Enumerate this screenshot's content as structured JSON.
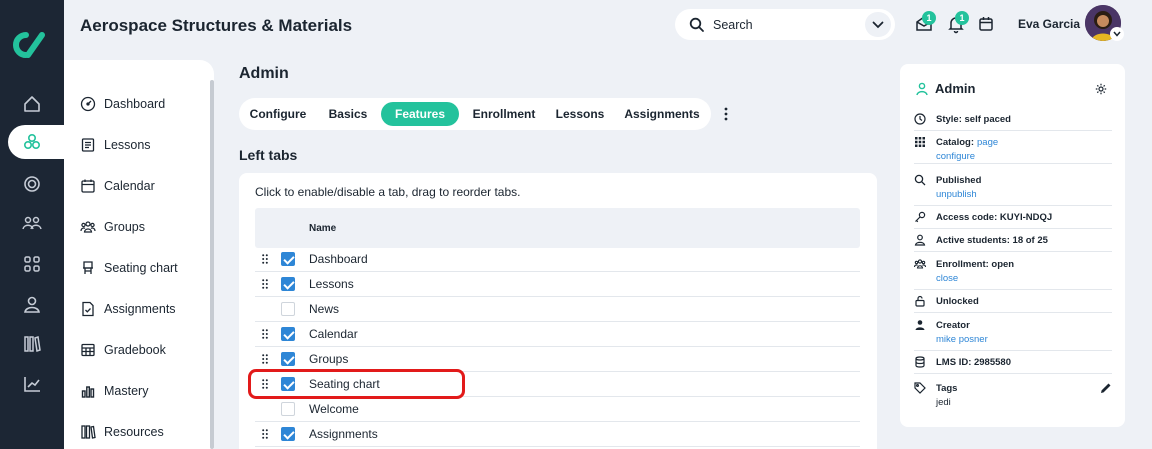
{
  "app": {
    "title": "Aerospace Structures & Materials"
  },
  "search": {
    "placeholder": "Search"
  },
  "notifications": {
    "inbox_count": "1",
    "bell_count": "1"
  },
  "user": {
    "name": "Eva Garcia"
  },
  "sidebar": {
    "items": [
      {
        "label": "Dashboard",
        "icon": "dashboard-icon"
      },
      {
        "label": "Lessons",
        "icon": "lessons-icon"
      },
      {
        "label": "Calendar",
        "icon": "calendar-icon"
      },
      {
        "label": "Groups",
        "icon": "groups-icon"
      },
      {
        "label": "Seating chart",
        "icon": "seating-chart-icon"
      },
      {
        "label": "Assignments",
        "icon": "assignments-icon"
      },
      {
        "label": "Gradebook",
        "icon": "gradebook-icon"
      },
      {
        "label": "Mastery",
        "icon": "mastery-icon"
      },
      {
        "label": "Resources",
        "icon": "resources-icon"
      }
    ]
  },
  "page": {
    "title": "Admin",
    "section_title": "Left tabs",
    "hint": "Click to enable/disable a tab, drag to reorder tabs."
  },
  "tabs": [
    {
      "label": "Configure"
    },
    {
      "label": "Basics"
    },
    {
      "label": "Features",
      "active": true
    },
    {
      "label": "Enrollment"
    },
    {
      "label": "Lessons"
    },
    {
      "label": "Assignments"
    }
  ],
  "table": {
    "header": "Name",
    "rows": [
      {
        "label": "Dashboard",
        "checked": true
      },
      {
        "label": "Lessons",
        "checked": true
      },
      {
        "label": "News",
        "checked": false
      },
      {
        "label": "Calendar",
        "checked": true
      },
      {
        "label": "Groups",
        "checked": true
      },
      {
        "label": "Seating chart",
        "checked": true
      },
      {
        "label": "Welcome",
        "checked": false
      },
      {
        "label": "Assignments",
        "checked": true
      }
    ]
  },
  "panel": {
    "title": "Admin",
    "style": "Style: self paced",
    "catalog": "Catalog:",
    "catalog_page": "page",
    "catalog_configure": "configure",
    "published": "Published",
    "unpublish": "unpublish",
    "access_code": "Access code: KUYI-NDQJ",
    "active_students": "Active students: 18 of 25",
    "enrollment": "Enrollment: open",
    "enrollment_close": "close",
    "unlocked": "Unlocked",
    "creator": "Creator",
    "creator_name": "mike posner",
    "lms_id": "LMS ID: 2985580",
    "tags": "Tags",
    "tag_value": "jedi"
  },
  "colors": {
    "accent": "#23c29c",
    "link": "#2e86d6",
    "highlight": "#e21a1a",
    "rail": "#1c2634"
  }
}
